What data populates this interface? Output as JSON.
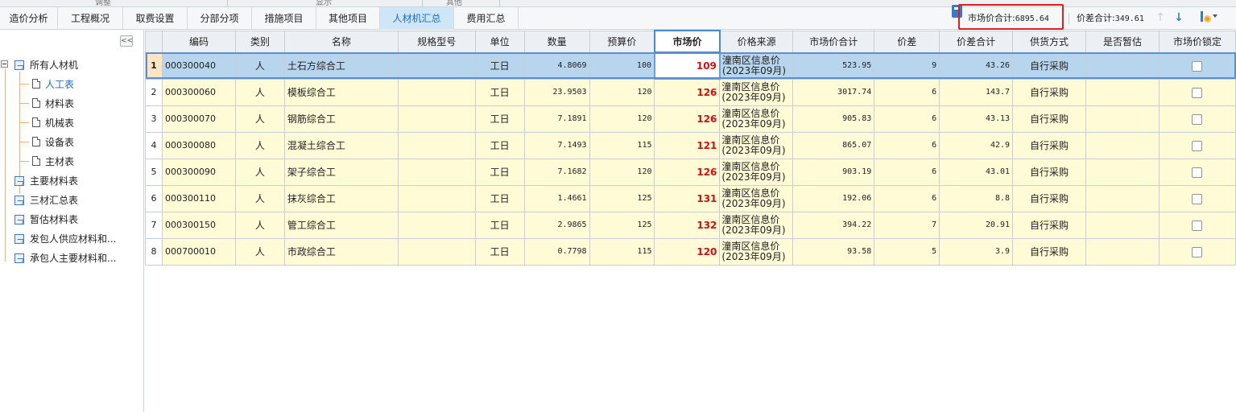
{
  "ribbon_cut": {
    "labels": [
      "调整",
      "显示",
      "其他"
    ]
  },
  "tabs": [
    {
      "label": "造价分析",
      "active": false
    },
    {
      "label": "工程概况",
      "active": false
    },
    {
      "label": "取费设置",
      "active": false
    },
    {
      "label": "分部分项",
      "active": false
    },
    {
      "label": "措施项目",
      "active": false
    },
    {
      "label": "其他项目",
      "active": false
    },
    {
      "label": "人材机汇总",
      "active": true
    },
    {
      "label": "费用汇总",
      "active": false
    }
  ],
  "toolbar": {
    "market_total_label": "市场价合计:",
    "market_total_value": "6895.64",
    "diff_total_label": "价差合计:",
    "diff_total_value": "349.61",
    "icons": [
      "calculator-icon",
      "arrow-up-icon",
      "arrow-down-icon",
      "settings-icon",
      "chevron-down-icon"
    ]
  },
  "sidebar": {
    "collapse_label": "<<",
    "tree": [
      {
        "label": "所有人材机",
        "level": 0,
        "icon": "folder-icon"
      },
      {
        "label": "人工表",
        "level": 1,
        "icon": "doc-icon",
        "selected": true
      },
      {
        "label": "材料表",
        "level": 1,
        "icon": "doc-icon"
      },
      {
        "label": "机械表",
        "level": 1,
        "icon": "doc-icon"
      },
      {
        "label": "设备表",
        "level": 1,
        "icon": "doc-icon"
      },
      {
        "label": "主材表",
        "level": 1,
        "icon": "doc-icon"
      },
      {
        "label": "主要材料表",
        "level": 0,
        "icon": "folder-icon"
      },
      {
        "label": "三材汇总表",
        "level": 0,
        "icon": "folder-icon"
      },
      {
        "label": "暂估材料表",
        "level": 0,
        "icon": "folder-icon"
      },
      {
        "label": "发包人供应材料和...",
        "level": 0,
        "icon": "folder-icon"
      },
      {
        "label": "承包人主要材料和...",
        "level": 0,
        "icon": "folder-icon"
      }
    ]
  },
  "grid": {
    "columns": [
      "",
      "编码",
      "类别",
      "名称",
      "规格型号",
      "单位",
      "数量",
      "预算价",
      "市场价",
      "价格来源",
      "市场价合计",
      "价差",
      "价差合计",
      "供货方式",
      "是否暂估",
      "市场价锁定"
    ],
    "highlight_column": "市场价",
    "rows": [
      {
        "no": "1",
        "code": "000300040",
        "type": "人",
        "name": "土石方综合工",
        "spec": "",
        "unit": "工日",
        "qty": "4.8069",
        "budget": "100",
        "market": "109",
        "src1": "潼南区信息价",
        "src2": "(2023年09月)",
        "mtotal": "523.95",
        "diff": "9",
        "dtotal": "43.26",
        "supply": "自行采购",
        "est": "",
        "lock": false,
        "selected": true
      },
      {
        "no": "2",
        "code": "000300060",
        "type": "人",
        "name": "模板综合工",
        "spec": "",
        "unit": "工日",
        "qty": "23.9503",
        "budget": "120",
        "market": "126",
        "src1": "潼南区信息价",
        "src2": "(2023年09月)",
        "mtotal": "3017.74",
        "diff": "6",
        "dtotal": "143.7",
        "supply": "自行采购",
        "est": "",
        "lock": false
      },
      {
        "no": "3",
        "code": "000300070",
        "type": "人",
        "name": "钢筋综合工",
        "spec": "",
        "unit": "工日",
        "qty": "7.1891",
        "budget": "120",
        "market": "126",
        "src1": "潼南区信息价",
        "src2": "(2023年09月)",
        "mtotal": "905.83",
        "diff": "6",
        "dtotal": "43.13",
        "supply": "自行采购",
        "est": "",
        "lock": false
      },
      {
        "no": "4",
        "code": "000300080",
        "type": "人",
        "name": "混凝土综合工",
        "spec": "",
        "unit": "工日",
        "qty": "7.1493",
        "budget": "115",
        "market": "121",
        "src1": "潼南区信息价",
        "src2": "(2023年09月)",
        "mtotal": "865.07",
        "diff": "6",
        "dtotal": "42.9",
        "supply": "自行采购",
        "est": "",
        "lock": false
      },
      {
        "no": "5",
        "code": "000300090",
        "type": "人",
        "name": "架子综合工",
        "spec": "",
        "unit": "工日",
        "qty": "7.1682",
        "budget": "120",
        "market": "126",
        "src1": "潼南区信息价",
        "src2": "(2023年09月)",
        "mtotal": "903.19",
        "diff": "6",
        "dtotal": "43.01",
        "supply": "自行采购",
        "est": "",
        "lock": false
      },
      {
        "no": "6",
        "code": "000300110",
        "type": "人",
        "name": "抹灰综合工",
        "spec": "",
        "unit": "工日",
        "qty": "1.4661",
        "budget": "125",
        "market": "131",
        "src1": "潼南区信息价",
        "src2": "(2023年09月)",
        "mtotal": "192.06",
        "diff": "6",
        "dtotal": "8.8",
        "supply": "自行采购",
        "est": "",
        "lock": false
      },
      {
        "no": "7",
        "code": "000300150",
        "type": "人",
        "name": "管工综合工",
        "spec": "",
        "unit": "工日",
        "qty": "2.9865",
        "budget": "125",
        "market": "132",
        "src1": "潼南区信息价",
        "src2": "(2023年09月)",
        "mtotal": "394.22",
        "diff": "7",
        "dtotal": "20.91",
        "supply": "自行采购",
        "est": "",
        "lock": false
      },
      {
        "no": "8",
        "code": "000700010",
        "type": "人",
        "name": "市政综合工",
        "spec": "",
        "unit": "工日",
        "qty": "0.7798",
        "budget": "115",
        "market": "120",
        "src1": "潼南区信息价",
        "src2": "(2023年09月)",
        "mtotal": "93.58",
        "diff": "5",
        "dtotal": "3.9",
        "supply": "自行采购",
        "est": "",
        "lock": false
      }
    ]
  },
  "colors": {
    "accent": "#1c6fb8",
    "row_bg": "#fffbd6",
    "selected_row_bg": "#b8d5ee",
    "market_price_text": "#d01010",
    "highlight_border": "#e02020"
  }
}
